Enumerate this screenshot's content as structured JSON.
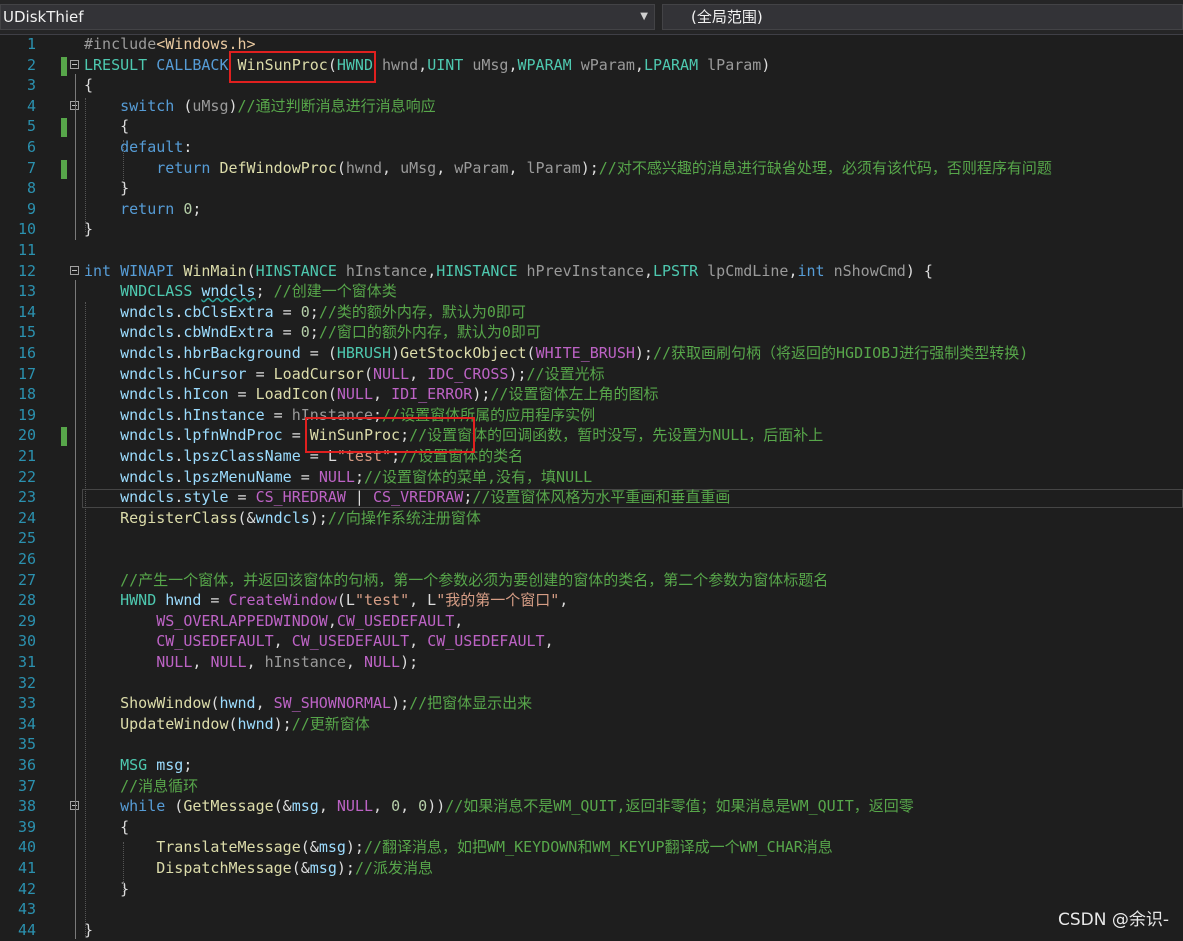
{
  "toolbar": {
    "project": "UDiskThief",
    "scope": "(全局范围)"
  },
  "watermark": "CSDN @余识-",
  "highlight_color": "#e0201f",
  "lines": [
    {
      "n": 1,
      "tokens": [
        [
          "pp",
          "#include"
        ],
        [
          "inc",
          "<Windows.h>"
        ]
      ]
    },
    {
      "n": 2,
      "tokens": [
        [
          "ty",
          "LRESULT"
        ],
        [
          "pl",
          " "
        ],
        [
          "kw",
          "CALLBACK"
        ],
        [
          "pl",
          " "
        ],
        [
          "fn",
          "WinSunProc"
        ],
        [
          "pl",
          "("
        ],
        [
          "ty",
          "HWND"
        ],
        [
          "pl",
          " "
        ],
        [
          "lc",
          "hwnd"
        ],
        [
          "pl",
          ","
        ],
        [
          "ty",
          "UINT"
        ],
        [
          "pl",
          " "
        ],
        [
          "lc",
          "uMsg"
        ],
        [
          "pl",
          ","
        ],
        [
          "ty",
          "WPARAM"
        ],
        [
          "pl",
          " "
        ],
        [
          "lc",
          "wParam"
        ],
        [
          "pl",
          ","
        ],
        [
          "ty",
          "LPARAM"
        ],
        [
          "pl",
          " "
        ],
        [
          "lc",
          "lParam"
        ],
        [
          "pl",
          ")"
        ]
      ]
    },
    {
      "n": 3,
      "tokens": [
        [
          "pl",
          "{"
        ]
      ]
    },
    {
      "n": 4,
      "tokens": [
        [
          "pl",
          "    "
        ],
        [
          "kw",
          "switch"
        ],
        [
          "pl",
          " ("
        ],
        [
          "lc",
          "uMsg"
        ],
        [
          "pl",
          ")"
        ],
        [
          "cm",
          "//通过判断消息进行消息响应"
        ]
      ]
    },
    {
      "n": 5,
      "tokens": [
        [
          "pl",
          "    {"
        ]
      ]
    },
    {
      "n": 6,
      "tokens": [
        [
          "pl",
          "    "
        ],
        [
          "kw",
          "default"
        ],
        [
          "pl",
          ":"
        ]
      ]
    },
    {
      "n": 7,
      "tokens": [
        [
          "pl",
          "        "
        ],
        [
          "kw",
          "return"
        ],
        [
          "pl",
          " "
        ],
        [
          "fn",
          "DefWindowProc"
        ],
        [
          "pl",
          "("
        ],
        [
          "lc",
          "hwnd"
        ],
        [
          "pl",
          ", "
        ],
        [
          "lc",
          "uMsg"
        ],
        [
          "pl",
          ", "
        ],
        [
          "lc",
          "wParam"
        ],
        [
          "pl",
          ", "
        ],
        [
          "lc",
          "lParam"
        ],
        [
          "pl",
          ");"
        ],
        [
          "cm",
          "//对不感兴趣的消息进行缺省处理，必须有该代码，否则程序有问题"
        ]
      ]
    },
    {
      "n": 8,
      "tokens": [
        [
          "pl",
          "    }"
        ]
      ]
    },
    {
      "n": 9,
      "tokens": [
        [
          "pl",
          "    "
        ],
        [
          "kw",
          "return"
        ],
        [
          "pl",
          " "
        ],
        [
          "nu",
          "0"
        ],
        [
          "pl",
          ";"
        ]
      ]
    },
    {
      "n": 10,
      "tokens": [
        [
          "pl",
          "}"
        ]
      ]
    },
    {
      "n": 11,
      "tokens": []
    },
    {
      "n": 12,
      "tokens": [
        [
          "kw",
          "int"
        ],
        [
          "pl",
          " "
        ],
        [
          "kw",
          "WINAPI"
        ],
        [
          "pl",
          " "
        ],
        [
          "fn",
          "WinMain"
        ],
        [
          "pl",
          "("
        ],
        [
          "ty",
          "HINSTANCE"
        ],
        [
          "pl",
          " "
        ],
        [
          "lc",
          "hInstance"
        ],
        [
          "pl",
          ","
        ],
        [
          "ty",
          "HINSTANCE"
        ],
        [
          "pl",
          " "
        ],
        [
          "lc",
          "hPrevInstance"
        ],
        [
          "pl",
          ","
        ],
        [
          "ty",
          "LPSTR"
        ],
        [
          "pl",
          " "
        ],
        [
          "lc",
          "lpCmdLine"
        ],
        [
          "pl",
          ","
        ],
        [
          "kw",
          "int"
        ],
        [
          "pl",
          " "
        ],
        [
          "lc",
          "nShowCmd"
        ],
        [
          "pl",
          ") {"
        ]
      ]
    },
    {
      "n": 13,
      "tokens": [
        [
          "pl",
          "    "
        ],
        [
          "ty",
          "WNDCLASS"
        ],
        [
          "pl",
          " "
        ],
        [
          "pr",
          "wndcls"
        ],
        [
          "pl",
          "; "
        ],
        [
          "cm",
          "//创建一个窗体类"
        ]
      ]
    },
    {
      "n": 14,
      "tokens": [
        [
          "pl",
          "    "
        ],
        [
          "pr",
          "wndcls"
        ],
        [
          "pl",
          "."
        ],
        [
          "pr",
          "cbClsExtra"
        ],
        [
          "pl",
          " = "
        ],
        [
          "nu",
          "0"
        ],
        [
          "pl",
          ";"
        ],
        [
          "cm",
          "//类的额外内存，默认为0即可"
        ]
      ]
    },
    {
      "n": 15,
      "tokens": [
        [
          "pl",
          "    "
        ],
        [
          "pr",
          "wndcls"
        ],
        [
          "pl",
          "."
        ],
        [
          "pr",
          "cbWndExtra"
        ],
        [
          "pl",
          " = "
        ],
        [
          "nu",
          "0"
        ],
        [
          "pl",
          ";"
        ],
        [
          "cm",
          "//窗口的额外内存，默认为0即可"
        ]
      ]
    },
    {
      "n": 16,
      "tokens": [
        [
          "pl",
          "    "
        ],
        [
          "pr",
          "wndcls"
        ],
        [
          "pl",
          "."
        ],
        [
          "pr",
          "hbrBackground"
        ],
        [
          "pl",
          " = ("
        ],
        [
          "ty",
          "HBRUSH"
        ],
        [
          "pl",
          ")"
        ],
        [
          "fn",
          "GetStockObject"
        ],
        [
          "pl",
          "("
        ],
        [
          "mc",
          "WHITE_BRUSH"
        ],
        [
          "pl",
          ");"
        ],
        [
          "cm",
          "//获取画刷句柄（将返回的HGDIOBJ进行强制类型转换)"
        ]
      ]
    },
    {
      "n": 17,
      "tokens": [
        [
          "pl",
          "    "
        ],
        [
          "pr",
          "wndcls"
        ],
        [
          "pl",
          "."
        ],
        [
          "pr",
          "hCursor"
        ],
        [
          "pl",
          " = "
        ],
        [
          "fn",
          "LoadCursor"
        ],
        [
          "pl",
          "("
        ],
        [
          "mc",
          "NULL"
        ],
        [
          "pl",
          ", "
        ],
        [
          "mc",
          "IDC_CROSS"
        ],
        [
          "pl",
          ");"
        ],
        [
          "cm",
          "//设置光标"
        ]
      ]
    },
    {
      "n": 18,
      "tokens": [
        [
          "pl",
          "    "
        ],
        [
          "pr",
          "wndcls"
        ],
        [
          "pl",
          "."
        ],
        [
          "pr",
          "hIcon"
        ],
        [
          "pl",
          " = "
        ],
        [
          "fn",
          "LoadIcon"
        ],
        [
          "pl",
          "("
        ],
        [
          "mc",
          "NULL"
        ],
        [
          "pl",
          ", "
        ],
        [
          "mc",
          "IDI_ERROR"
        ],
        [
          "pl",
          ");"
        ],
        [
          "cm",
          "//设置窗体左上角的图标"
        ]
      ]
    },
    {
      "n": 19,
      "tokens": [
        [
          "pl",
          "    "
        ],
        [
          "pr",
          "wndcls"
        ],
        [
          "pl",
          "."
        ],
        [
          "pr",
          "hInstance"
        ],
        [
          "pl",
          " = "
        ],
        [
          "lc",
          "hInstance"
        ],
        [
          "pl",
          ";"
        ],
        [
          "cm",
          "//设置窗体所属的应用程序实例"
        ]
      ]
    },
    {
      "n": 20,
      "tokens": [
        [
          "pl",
          "    "
        ],
        [
          "pr",
          "wndcls"
        ],
        [
          "pl",
          "."
        ],
        [
          "pr",
          "lpfnWndProc"
        ],
        [
          "pl",
          " = "
        ],
        [
          "fn",
          "WinSunProc"
        ],
        [
          "pl",
          ";"
        ],
        [
          "cm",
          "//设置窗体的回调函数，暂时没写，先设置为NULL，后面补上"
        ]
      ]
    },
    {
      "n": 21,
      "tokens": [
        [
          "pl",
          "    "
        ],
        [
          "pr",
          "wndcls"
        ],
        [
          "pl",
          "."
        ],
        [
          "pr",
          "lpszClassName"
        ],
        [
          "pl",
          " = L"
        ],
        [
          "st",
          "\"test\""
        ],
        [
          "pl",
          ";"
        ],
        [
          "cm",
          "//设置窗体的类名"
        ]
      ]
    },
    {
      "n": 22,
      "tokens": [
        [
          "pl",
          "    "
        ],
        [
          "pr",
          "wndcls"
        ],
        [
          "pl",
          "."
        ],
        [
          "pr",
          "lpszMenuName"
        ],
        [
          "pl",
          " = "
        ],
        [
          "mc",
          "NULL"
        ],
        [
          "pl",
          ";"
        ],
        [
          "cm",
          "//设置窗体的菜单,没有，填NULL"
        ]
      ]
    },
    {
      "n": 23,
      "tokens": [
        [
          "pl",
          "    "
        ],
        [
          "pr",
          "wndcls"
        ],
        [
          "pl",
          "."
        ],
        [
          "pr",
          "style"
        ],
        [
          "pl",
          " = "
        ],
        [
          "mc",
          "CS_HREDRAW"
        ],
        [
          "pl",
          " | "
        ],
        [
          "mc",
          "CS_VREDRAW"
        ],
        [
          "pl",
          ";"
        ],
        [
          "cm",
          "//设置窗体风格为水平重画和垂直重画"
        ]
      ]
    },
    {
      "n": 24,
      "tokens": [
        [
          "pl",
          "    "
        ],
        [
          "fn",
          "RegisterClass"
        ],
        [
          "pl",
          "(&"
        ],
        [
          "pr",
          "wndcls"
        ],
        [
          "pl",
          ");"
        ],
        [
          "cm",
          "//向操作系统注册窗体"
        ]
      ]
    },
    {
      "n": 25,
      "tokens": []
    },
    {
      "n": 26,
      "tokens": []
    },
    {
      "n": 27,
      "tokens": [
        [
          "pl",
          "    "
        ],
        [
          "cm",
          "//产生一个窗体，并返回该窗体的句柄，第一个参数必须为要创建的窗体的类名，第二个参数为窗体标题名"
        ]
      ]
    },
    {
      "n": 28,
      "tokens": [
        [
          "pl",
          "    "
        ],
        [
          "ty",
          "HWND"
        ],
        [
          "pl",
          " "
        ],
        [
          "pr",
          "hwnd"
        ],
        [
          "pl",
          " = "
        ],
        [
          "mc",
          "CreateWindow"
        ],
        [
          "pl",
          "(L"
        ],
        [
          "st",
          "\"test\""
        ],
        [
          "pl",
          ", L"
        ],
        [
          "st",
          "\"我的第一个窗口\""
        ],
        [
          "pl",
          ","
        ]
      ]
    },
    {
      "n": 29,
      "tokens": [
        [
          "pl",
          "        "
        ],
        [
          "mc",
          "WS_OVERLAPPEDWINDOW"
        ],
        [
          "pl",
          ","
        ],
        [
          "mc",
          "CW_USEDEFAULT"
        ],
        [
          "pl",
          ","
        ]
      ]
    },
    {
      "n": 30,
      "tokens": [
        [
          "pl",
          "        "
        ],
        [
          "mc",
          "CW_USEDEFAULT"
        ],
        [
          "pl",
          ", "
        ],
        [
          "mc",
          "CW_USEDEFAULT"
        ],
        [
          "pl",
          ", "
        ],
        [
          "mc",
          "CW_USEDEFAULT"
        ],
        [
          "pl",
          ","
        ]
      ]
    },
    {
      "n": 31,
      "tokens": [
        [
          "pl",
          "        "
        ],
        [
          "mc",
          "NULL"
        ],
        [
          "pl",
          ", "
        ],
        [
          "mc",
          "NULL"
        ],
        [
          "pl",
          ", "
        ],
        [
          "lc",
          "hInstance"
        ],
        [
          "pl",
          ", "
        ],
        [
          "mc",
          "NULL"
        ],
        [
          "pl",
          ");"
        ]
      ]
    },
    {
      "n": 32,
      "tokens": []
    },
    {
      "n": 33,
      "tokens": [
        [
          "pl",
          "    "
        ],
        [
          "fn",
          "ShowWindow"
        ],
        [
          "pl",
          "("
        ],
        [
          "pr",
          "hwnd"
        ],
        [
          "pl",
          ", "
        ],
        [
          "mc",
          "SW_SHOWNORMAL"
        ],
        [
          "pl",
          ");"
        ],
        [
          "cm",
          "//把窗体显示出来"
        ]
      ]
    },
    {
      "n": 34,
      "tokens": [
        [
          "pl",
          "    "
        ],
        [
          "fn",
          "UpdateWindow"
        ],
        [
          "pl",
          "("
        ],
        [
          "pr",
          "hwnd"
        ],
        [
          "pl",
          ");"
        ],
        [
          "cm",
          "//更新窗体"
        ]
      ]
    },
    {
      "n": 35,
      "tokens": []
    },
    {
      "n": 36,
      "tokens": [
        [
          "pl",
          "    "
        ],
        [
          "ty",
          "MSG"
        ],
        [
          "pl",
          " "
        ],
        [
          "pr",
          "msg"
        ],
        [
          "pl",
          ";"
        ]
      ]
    },
    {
      "n": 37,
      "tokens": [
        [
          "pl",
          "    "
        ],
        [
          "cm",
          "//消息循环"
        ]
      ]
    },
    {
      "n": 38,
      "tokens": [
        [
          "pl",
          "    "
        ],
        [
          "kw",
          "while"
        ],
        [
          "pl",
          " ("
        ],
        [
          "fn",
          "GetMessage"
        ],
        [
          "pl",
          "(&"
        ],
        [
          "pr",
          "msg"
        ],
        [
          "pl",
          ", "
        ],
        [
          "mc",
          "NULL"
        ],
        [
          "pl",
          ", "
        ],
        [
          "nu",
          "0"
        ],
        [
          "pl",
          ", "
        ],
        [
          "nu",
          "0"
        ],
        [
          "pl",
          "))"
        ],
        [
          "cm",
          "//如果消息不是WM_QUIT,返回非零值；如果消息是WM_QUIT，返回零"
        ]
      ]
    },
    {
      "n": 39,
      "tokens": [
        [
          "pl",
          "    {"
        ]
      ]
    },
    {
      "n": 40,
      "tokens": [
        [
          "pl",
          "        "
        ],
        [
          "fn",
          "TranslateMessage"
        ],
        [
          "pl",
          "(&"
        ],
        [
          "pr",
          "msg"
        ],
        [
          "pl",
          ");"
        ],
        [
          "cm",
          "//翻译消息，如把WM_KEYDOWN和WM_KEYUP翻译成一个WM_CHAR消息"
        ]
      ]
    },
    {
      "n": 41,
      "tokens": [
        [
          "pl",
          "        "
        ],
        [
          "fn",
          "DispatchMessage"
        ],
        [
          "pl",
          "(&"
        ],
        [
          "pr",
          "msg"
        ],
        [
          "pl",
          ");"
        ],
        [
          "cm",
          "//派发消息"
        ]
      ]
    },
    {
      "n": 42,
      "tokens": [
        [
          "pl",
          "    }"
        ]
      ]
    },
    {
      "n": 43,
      "tokens": []
    },
    {
      "n": 44,
      "tokens": [
        [
          "pl",
          "}"
        ]
      ]
    }
  ]
}
